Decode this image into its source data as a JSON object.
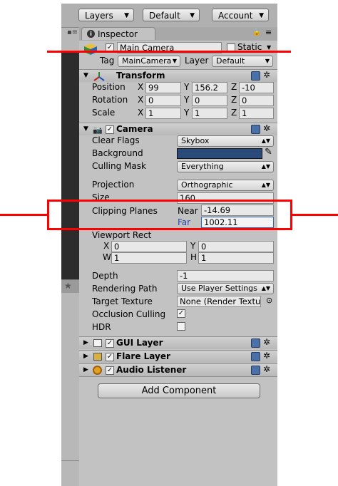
{
  "toolbar": {
    "layers": "Layers",
    "layout": "Default",
    "account": "Account"
  },
  "tab": {
    "label": "Inspector"
  },
  "object": {
    "name": "Main Camera",
    "static_label": "Static",
    "tag_label": "Tag",
    "tag_value": "MainCamera",
    "layer_label": "Layer",
    "layer_value": "Default"
  },
  "transform": {
    "title": "Transform",
    "position_label": "Position",
    "rotation_label": "Rotation",
    "scale_label": "Scale",
    "axis_x": "X",
    "axis_y": "Y",
    "axis_z": "Z",
    "position": {
      "x": "99",
      "y": "156.2",
      "z": "-10"
    },
    "rotation": {
      "x": "0",
      "y": "0",
      "z": "0"
    },
    "scale": {
      "x": "1",
      "y": "1",
      "z": "1"
    }
  },
  "camera": {
    "title": "Camera",
    "clear_flags_label": "Clear Flags",
    "clear_flags": "Skybox",
    "background_label": "Background",
    "background_color": "#2a4a7a",
    "culling_mask_label": "Culling Mask",
    "culling_mask": "Everything",
    "projection_label": "Projection",
    "projection": "Orthographic",
    "size_label": "Size",
    "size": "160",
    "clipping_label": "Clipping Planes",
    "near_label": "Near",
    "near": "-14.69",
    "far_label": "Far",
    "far": "1002.11",
    "viewport_label": "Viewport Rect",
    "vp_x_label": "X",
    "vp_y_label": "Y",
    "vp_w_label": "W",
    "vp_h_label": "H",
    "vp_x": "0",
    "vp_y": "0",
    "vp_w": "1",
    "vp_h": "1",
    "depth_label": "Depth",
    "depth": "-1",
    "rendering_path_label": "Rendering Path",
    "rendering_path": "Use Player Settings",
    "target_texture_label": "Target Texture",
    "target_texture": "None (Render Textu",
    "occlusion_label": "Occlusion Culling",
    "hdr_label": "HDR"
  },
  "components": {
    "gui_layer": "GUI Layer",
    "flare_layer": "Flare Layer",
    "audio_listener": "Audio Listener"
  },
  "add_component": "Add Component",
  "colors": {
    "highlight": "#ff0000",
    "accent": "#2a4a7a"
  }
}
